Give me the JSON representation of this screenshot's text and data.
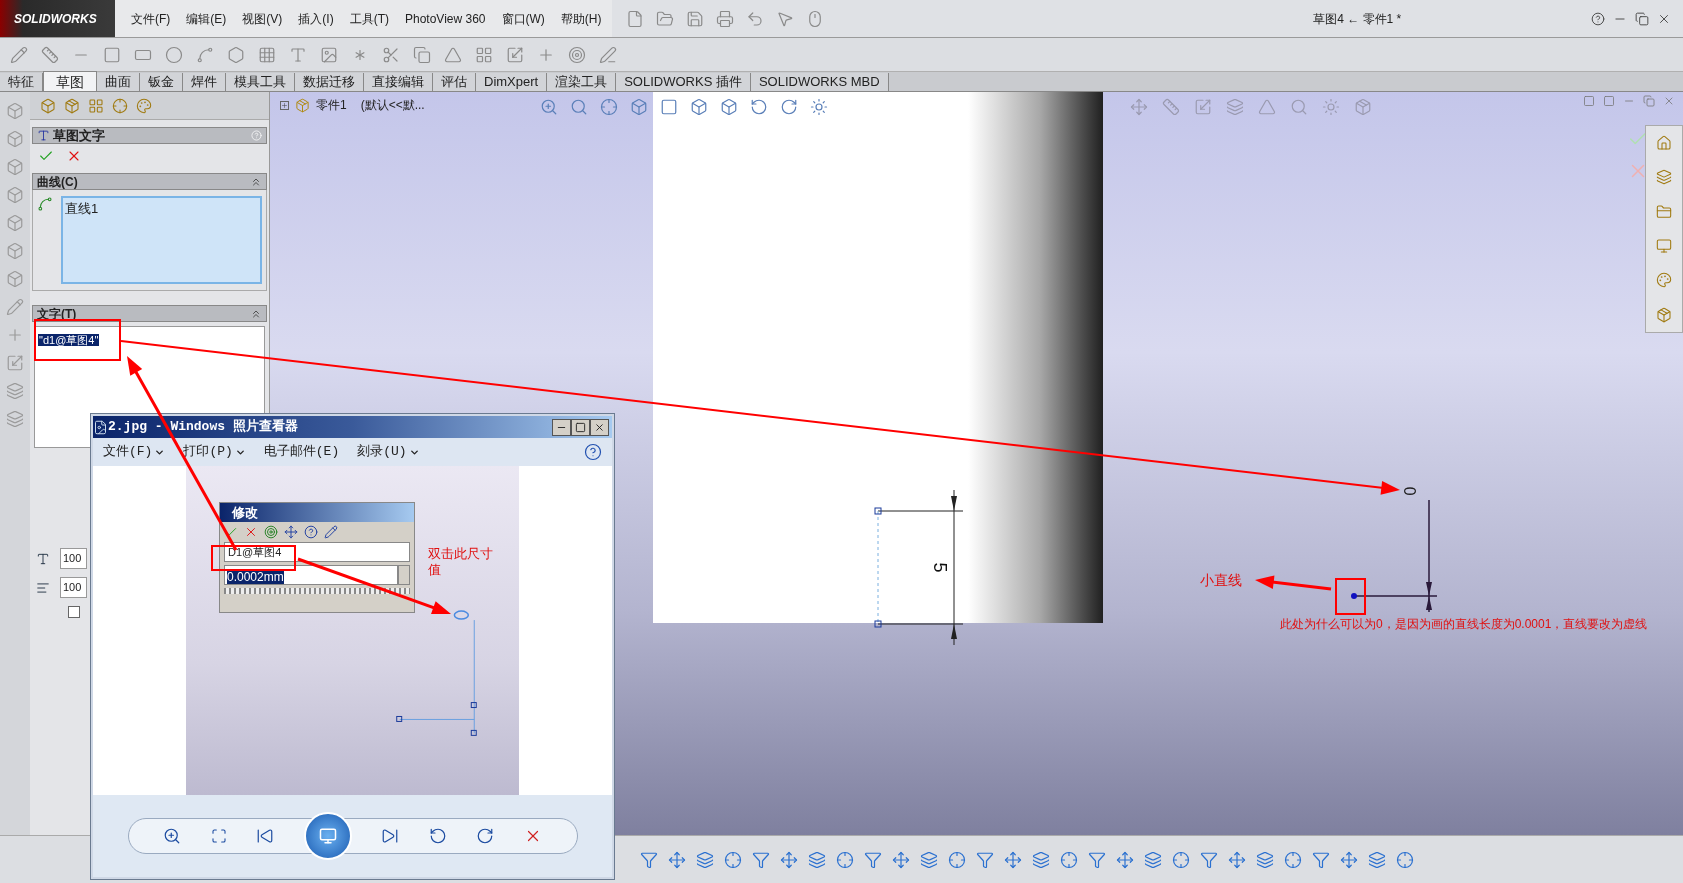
{
  "app": {
    "logo": "SOLIDWORKS",
    "document_title": "草图4 ← 零件1 *",
    "menu": [
      "文件(F)",
      "编辑(E)",
      "视图(V)",
      "插入(I)",
      "工具(T)",
      "PhotoView 360",
      "窗口(W)",
      "帮助(H)"
    ]
  },
  "command_tabs": [
    {
      "label": "特征",
      "selected": false
    },
    {
      "label": "草图",
      "selected": true
    },
    {
      "label": "曲面",
      "selected": false
    },
    {
      "label": "钣金",
      "selected": false
    },
    {
      "label": "焊件",
      "selected": false
    },
    {
      "label": "模具工具",
      "selected": false
    },
    {
      "label": "数据迁移",
      "selected": false
    },
    {
      "label": "直接编辑",
      "selected": false
    },
    {
      "label": "评估",
      "selected": false
    },
    {
      "label": "DimXpert",
      "selected": false
    },
    {
      "label": "渲染工具",
      "selected": false
    },
    {
      "label": "SOLIDWORKS 插件",
      "selected": false
    },
    {
      "label": "SOLIDWORKS MBD",
      "selected": false
    }
  ],
  "property_manager": {
    "title": "草图文字",
    "curves_section": {
      "title": "曲线(C)",
      "items": [
        "直线1"
      ]
    },
    "text_section": {
      "title": "文字(T)",
      "value": "\"d1@草图4\"",
      "selected": true
    },
    "fields": [
      "100",
      "100"
    ],
    "checkbox": {
      "checked": false
    }
  },
  "feature_tree": {
    "root": "零件1",
    "config": "(默认<<默..."
  },
  "graphics": {
    "dimension": "5",
    "zero_dimension": "0",
    "annotations": [
      {
        "text": "小直线"
      },
      {
        "text": "此处为什么可以为0，是因为画的直线长度为0.0001，直线要改为虚线"
      }
    ]
  },
  "photo_viewer": {
    "title": "2.jpg - Windows 照片查看器",
    "menu": [
      {
        "label": "文件(F)",
        "dropdown": true
      },
      {
        "label": "打印(P)",
        "dropdown": true
      },
      {
        "label": "电子邮件(E)",
        "dropdown": false
      },
      {
        "label": "刻录(U)",
        "dropdown": true
      }
    ],
    "modify_dialog": {
      "title": "修改",
      "name": "D1@草图4",
      "value": "0.0002mm",
      "value_selected": true
    },
    "note": "双击此尺寸值"
  }
}
